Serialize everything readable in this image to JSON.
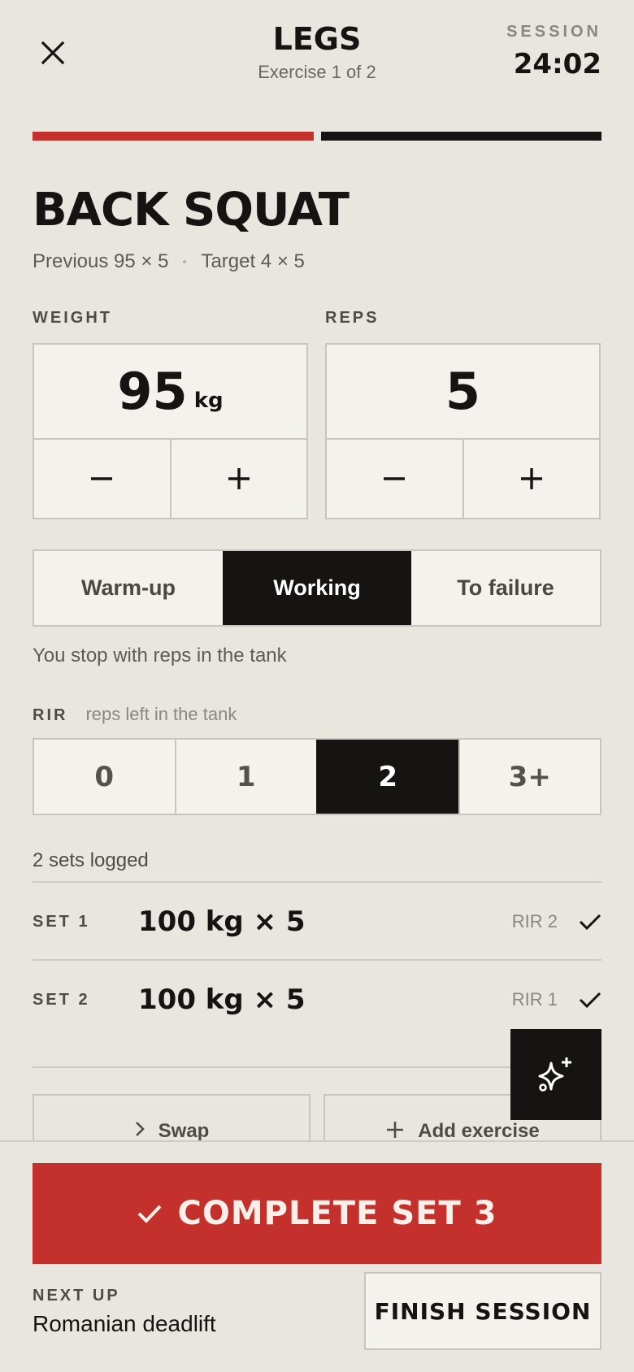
{
  "header": {
    "workout_title": "LEGS",
    "exercise_progress": "Exercise 1 of 2",
    "session_label": "SESSION",
    "session_time": "24:02"
  },
  "progress": {
    "segments": [
      {
        "state": "current",
        "color": "#c4312c"
      },
      {
        "state": "upcoming",
        "color": "#151412"
      }
    ]
  },
  "exercise": {
    "name": "BACK SQUAT",
    "previous": "Previous 95 × 5",
    "target": "Target 4 × 5"
  },
  "weight": {
    "label": "WEIGHT",
    "value": "95",
    "unit": "kg"
  },
  "reps": {
    "label": "REPS",
    "value": "5"
  },
  "set_type": {
    "options": [
      "Warm-up",
      "Working",
      "To failure"
    ],
    "selected": "Working",
    "description": "You stop with reps in the tank"
  },
  "rir": {
    "label": "RIR",
    "hint": "reps left in the tank",
    "options": [
      "0",
      "1",
      "2",
      "3+"
    ],
    "selected": "2"
  },
  "log": {
    "summary": "2 sets logged",
    "sets": [
      {
        "label": "SET 1",
        "value": "100 kg × 5",
        "rir": "RIR 2"
      },
      {
        "label": "SET 2",
        "value": "100 kg × 5",
        "rir": "RIR 1"
      }
    ]
  },
  "actions": {
    "swap": "Swap",
    "add_exercise": "Add exercise"
  },
  "footer": {
    "complete_label": "COMPLETE SET 3",
    "next_up_label": "NEXT UP",
    "next_up_name": "Romanian deadlift",
    "finish_label": "FINISH SESSION"
  },
  "icons": {
    "close": "close-icon",
    "minus": "minus-icon",
    "plus": "plus-icon",
    "check": "check-icon",
    "sparkle": "sparkle-icon",
    "chevron": "chevron-right-icon"
  },
  "colors": {
    "background": "#e9e6e0",
    "accent": "#c4312c",
    "ink": "#151412"
  }
}
